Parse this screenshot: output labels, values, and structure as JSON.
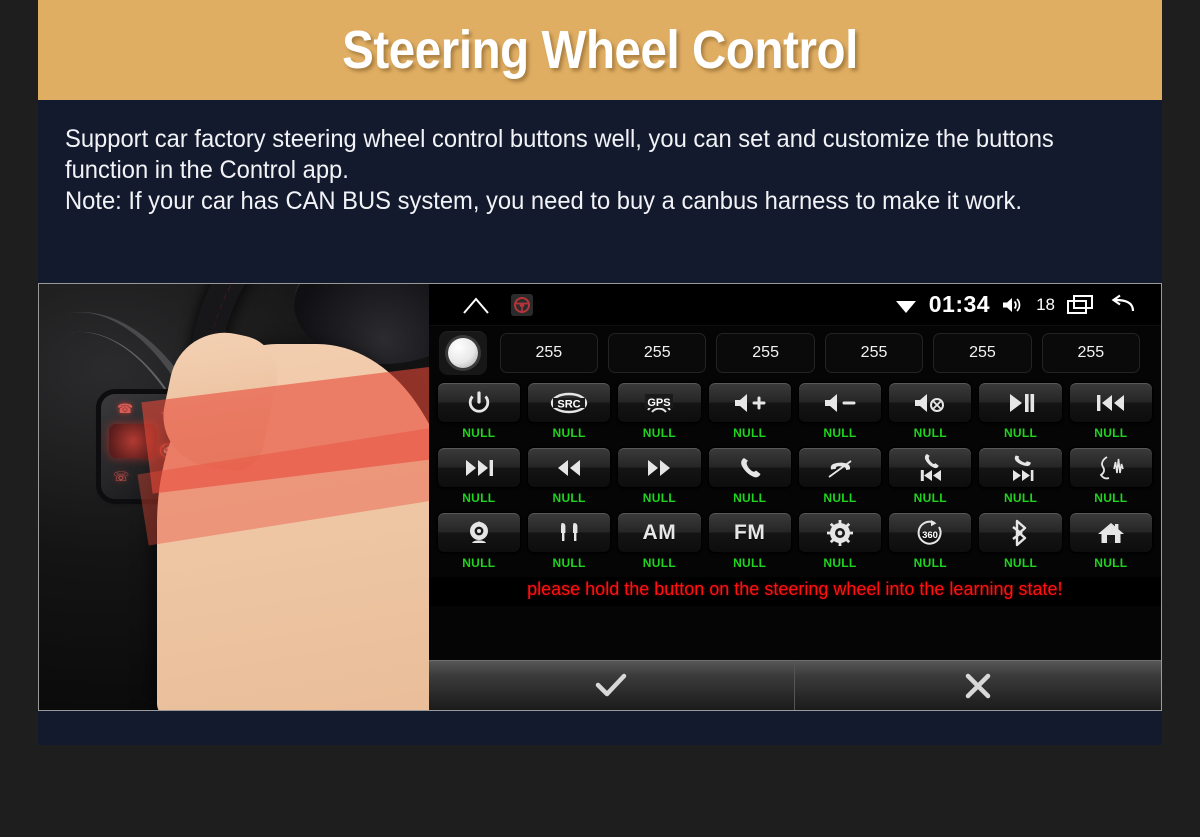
{
  "banner": {
    "title": "Steering Wheel Control",
    "bg_color": "#E0AE63",
    "text_color": "#FFFFFF"
  },
  "description": {
    "line1": "Support car factory steering wheel control buttons well, you can set and customize the buttons function in the Control app.",
    "line2": "Note: If your car has CAN BUS system, you need to buy a canbus harness to make it work."
  },
  "photo": {
    "alt": "Hand gripping car steering wheel showing factory control buttons",
    "wheel_buttons": [
      "phone-call",
      "volume-up",
      "voice-mic",
      "mute",
      "hang-up",
      "volume-down"
    ]
  },
  "unit_screenshot": {
    "statusbar": {
      "home_icon": "home-icon",
      "app_icon": "steering-wheel-icon",
      "wifi_icon": "wifi-icon",
      "time": "01:34",
      "volume_icon": "volume-icon",
      "volume_level": "18",
      "recents_icon": "recents-icon",
      "back_icon": "back-icon"
    },
    "knob_icon": "learning-knob-indicator",
    "values": [
      "255",
      "255",
      "255",
      "255",
      "255",
      "255"
    ],
    "buttons": [
      {
        "icon": "power-icon",
        "label": "NULL"
      },
      {
        "icon": "src-icon",
        "label": "NULL"
      },
      {
        "icon": "gps-icon",
        "label": "NULL"
      },
      {
        "icon": "volume-up-icon",
        "label": "NULL"
      },
      {
        "icon": "volume-down-icon",
        "label": "NULL"
      },
      {
        "icon": "mute-icon",
        "label": "NULL"
      },
      {
        "icon": "play-pause-icon",
        "label": "NULL"
      },
      {
        "icon": "previous-track-icon",
        "label": "NULL"
      },
      {
        "icon": "next-track-icon",
        "label": "NULL"
      },
      {
        "icon": "rewind-icon",
        "label": "NULL"
      },
      {
        "icon": "fast-forward-icon",
        "label": "NULL"
      },
      {
        "icon": "answer-call-icon",
        "label": "NULL"
      },
      {
        "icon": "hang-up-icon",
        "label": "NULL"
      },
      {
        "icon": "phone-previous-icon",
        "label": "NULL"
      },
      {
        "icon": "phone-next-icon",
        "label": "NULL"
      },
      {
        "icon": "voice-command-icon",
        "label": "NULL"
      },
      {
        "icon": "camera-icon",
        "label": "NULL"
      },
      {
        "icon": "aux-icon",
        "label": "NULL"
      },
      {
        "icon": "am-text",
        "text": "AM",
        "label": "NULL"
      },
      {
        "icon": "fm-text",
        "text": "FM",
        "label": "NULL"
      },
      {
        "icon": "settings-gear-icon",
        "label": "NULL"
      },
      {
        "icon": "360-view-icon",
        "text": "360",
        "label": "NULL"
      },
      {
        "icon": "bluetooth-icon",
        "label": "NULL"
      },
      {
        "icon": "home-icon",
        "label": "NULL"
      }
    ],
    "notice": "please hold the button on the steering wheel into the learning state!",
    "notice_color": "#FF1111",
    "confirm_icon": "check-icon",
    "cancel_icon": "close-icon",
    "null_label_color": "#1FD41F"
  }
}
